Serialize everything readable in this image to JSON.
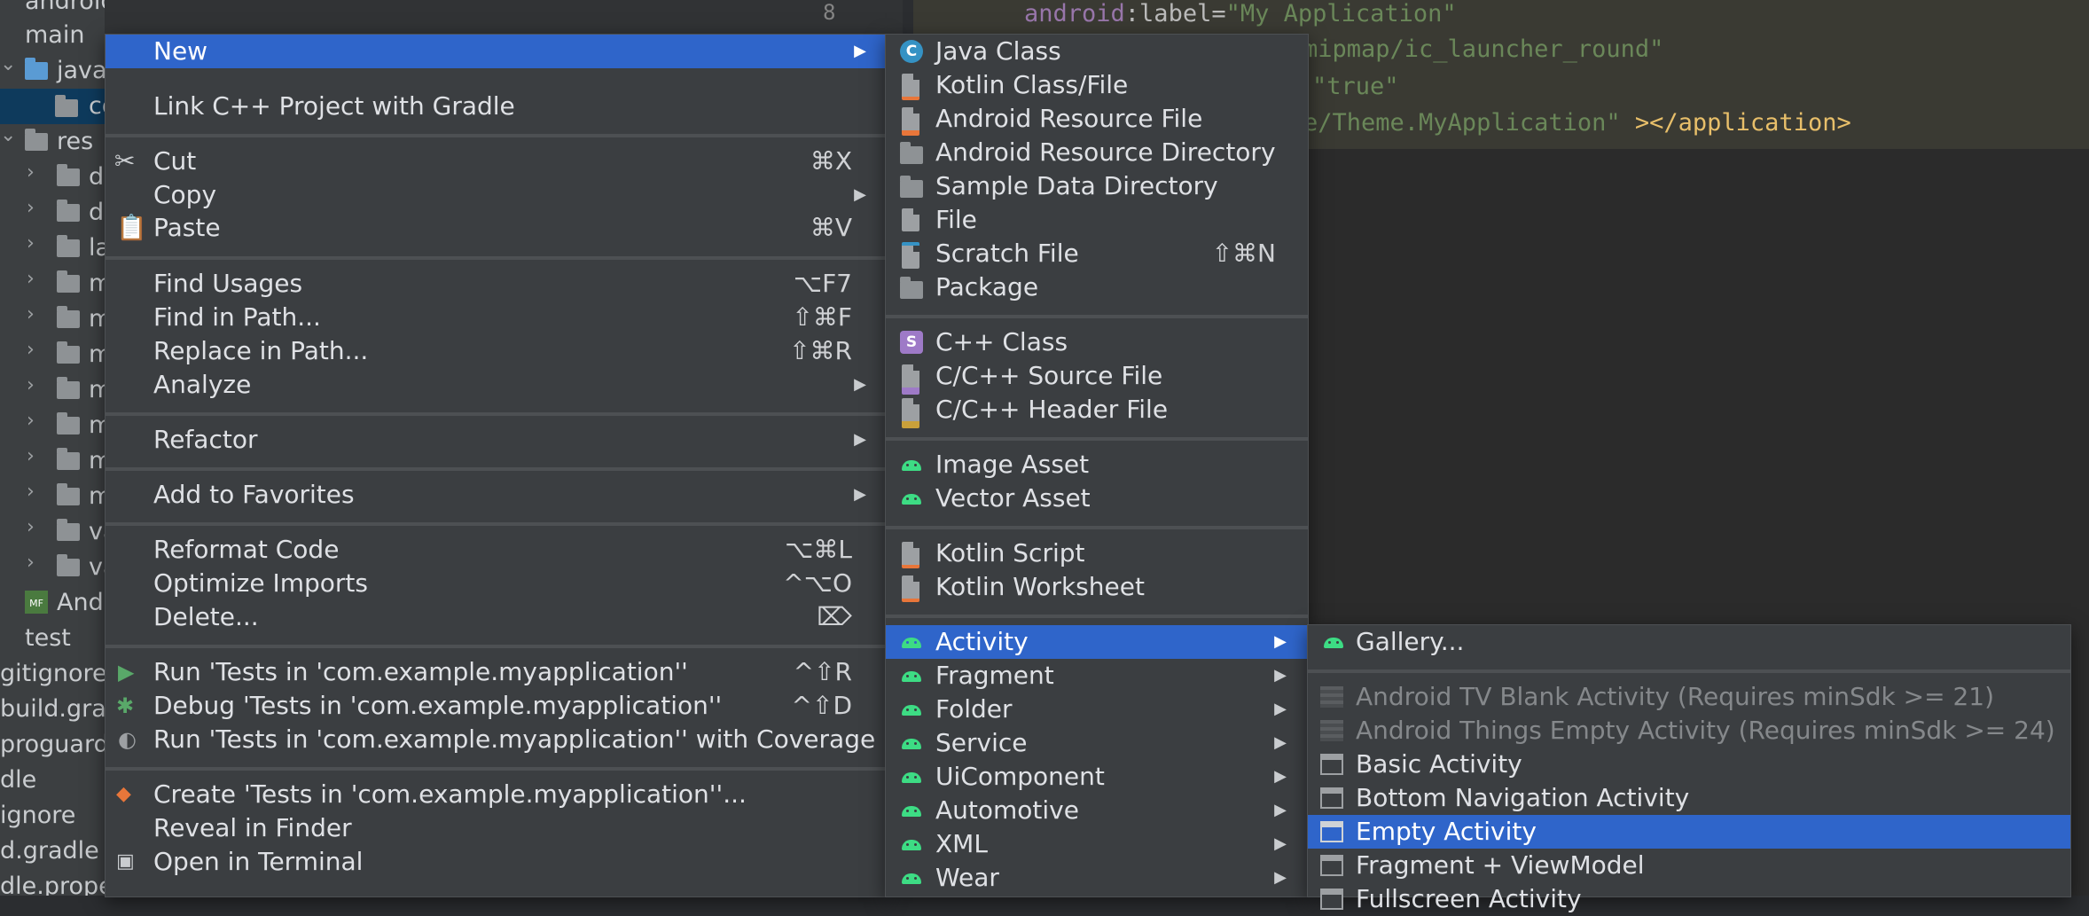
{
  "tree": {
    "rows": [
      {
        "label": "androidTest"
      },
      {
        "label": "main"
      },
      {
        "label": "java"
      },
      {
        "label": "co"
      },
      {
        "label": "res"
      },
      {
        "label": "d"
      },
      {
        "label": "d"
      },
      {
        "label": "la"
      },
      {
        "label": "m"
      },
      {
        "label": "m"
      },
      {
        "label": "m"
      },
      {
        "label": "m"
      },
      {
        "label": "m"
      },
      {
        "label": "m"
      },
      {
        "label": "m"
      },
      {
        "label": "va"
      },
      {
        "label": "va"
      },
      {
        "label": "Andr"
      },
      {
        "label": "test"
      },
      {
        "label": "gitignore"
      },
      {
        "label": "build.grad"
      },
      {
        "label": "proguard-"
      },
      {
        "label": "dle"
      },
      {
        "label": "ignore"
      },
      {
        "label": "d.gradle"
      },
      {
        "label": "dle.prope"
      }
    ]
  },
  "editor": {
    "line_number": "8",
    "lines": [
      {
        "attr_ns": "android",
        "attr": ":label=",
        "value": "\"My Application\""
      },
      {
        "value": "mipmap/ic_launcher_round\""
      },
      {
        "value": "\"true\""
      },
      {
        "value": "e/Theme.MyApplication\"",
        "tag": " ></application>"
      }
    ]
  },
  "menu1": {
    "items": [
      {
        "label": "New",
        "shortcut": "",
        "submenu": true
      },
      {
        "label": "Link C++ Project with Gradle",
        "shortcut": ""
      },
      {
        "label": "Cut",
        "shortcut": "⌘X",
        "icon": "scissors-icon"
      },
      {
        "label": "Copy",
        "shortcut": "",
        "submenu": true
      },
      {
        "label": "Paste",
        "shortcut": "⌘V",
        "icon": "clipboard-icon"
      },
      {
        "label": "Find Usages",
        "shortcut": "⌥F7"
      },
      {
        "label": "Find in Path...",
        "shortcut": "⇧⌘F"
      },
      {
        "label": "Replace in Path...",
        "shortcut": "⇧⌘R"
      },
      {
        "label": "Analyze",
        "shortcut": "",
        "submenu": true
      },
      {
        "label": "Refactor",
        "shortcut": "",
        "submenu": true
      },
      {
        "label": "Add to Favorites",
        "shortcut": "",
        "submenu": true
      },
      {
        "label": "Reformat Code",
        "shortcut": "⌥⌘L"
      },
      {
        "label": "Optimize Imports",
        "shortcut": "^⌥O"
      },
      {
        "label": "Delete...",
        "shortcut": "⌦"
      },
      {
        "label": "Run 'Tests in 'com.example.myapplication''",
        "shortcut": "^⇧R",
        "icon": "run-icon"
      },
      {
        "label": "Debug 'Tests in 'com.example.myapplication''",
        "shortcut": "^⇧D",
        "icon": "debug-icon"
      },
      {
        "label": "Run 'Tests in 'com.example.myapplication'' with Coverage",
        "shortcut": "",
        "icon": "coverage-icon"
      },
      {
        "label": "Create 'Tests in 'com.example.myapplication''...",
        "shortcut": "",
        "icon": "create-test-icon"
      },
      {
        "label": "Reveal in Finder",
        "shortcut": ""
      },
      {
        "label": "Open in Terminal",
        "shortcut": "",
        "icon": "terminal-icon"
      }
    ]
  },
  "menu2": {
    "items": [
      {
        "label": "Java Class",
        "icon": "java-class-icon"
      },
      {
        "label": "Kotlin Class/File",
        "icon": "kotlin-file-icon"
      },
      {
        "label": "Android Resource File",
        "icon": "android-resource-file-icon"
      },
      {
        "label": "Android Resource Directory",
        "icon": "folder-icon"
      },
      {
        "label": "Sample Data Directory",
        "icon": "folder-icon"
      },
      {
        "label": "File",
        "icon": "file-icon"
      },
      {
        "label": "Scratch File",
        "shortcut": "⇧⌘N",
        "icon": "scratch-file-icon"
      },
      {
        "label": "Package",
        "icon": "package-icon"
      },
      {
        "label": "C++ Class",
        "icon": "cpp-class-icon"
      },
      {
        "label": "C/C++ Source File",
        "icon": "cpp-source-icon"
      },
      {
        "label": "C/C++ Header File",
        "icon": "cpp-header-icon"
      },
      {
        "label": "Image Asset",
        "icon": "android-icon"
      },
      {
        "label": "Vector Asset",
        "icon": "android-icon"
      },
      {
        "label": "Kotlin Script",
        "icon": "kotlin-script-icon"
      },
      {
        "label": "Kotlin Worksheet",
        "icon": "kotlin-worksheet-icon"
      },
      {
        "label": "Activity",
        "icon": "android-icon",
        "submenu": true
      },
      {
        "label": "Fragment",
        "icon": "android-icon",
        "submenu": true
      },
      {
        "label": "Folder",
        "icon": "android-icon",
        "submenu": true
      },
      {
        "label": "Service",
        "icon": "android-icon",
        "submenu": true
      },
      {
        "label": "UiComponent",
        "icon": "android-icon",
        "submenu": true
      },
      {
        "label": "Automotive",
        "icon": "android-icon",
        "submenu": true
      },
      {
        "label": "XML",
        "icon": "android-icon",
        "submenu": true
      },
      {
        "label": "Wear",
        "icon": "android-icon",
        "submenu": true
      }
    ]
  },
  "menu3": {
    "items": [
      {
        "label": "Gallery...",
        "icon": "android-icon"
      },
      {
        "label": "Android TV Blank Activity (Requires minSdk >= 21)",
        "icon": "activity-template-icon",
        "disabled": true
      },
      {
        "label": "Android Things Empty Activity (Requires minSdk >= 24)",
        "icon": "activity-template-icon",
        "disabled": true
      },
      {
        "label": "Basic Activity",
        "icon": "activity-template-icon"
      },
      {
        "label": "Bottom Navigation Activity",
        "icon": "activity-template-icon"
      },
      {
        "label": "Empty Activity",
        "icon": "activity-template-icon"
      },
      {
        "label": "Fragment + ViewModel",
        "icon": "activity-template-icon"
      },
      {
        "label": "Fullscreen Activity",
        "icon": "activity-template-icon"
      }
    ]
  },
  "colors": {
    "highlight": "#2f65ca",
    "android_green": "#3ddc84"
  }
}
